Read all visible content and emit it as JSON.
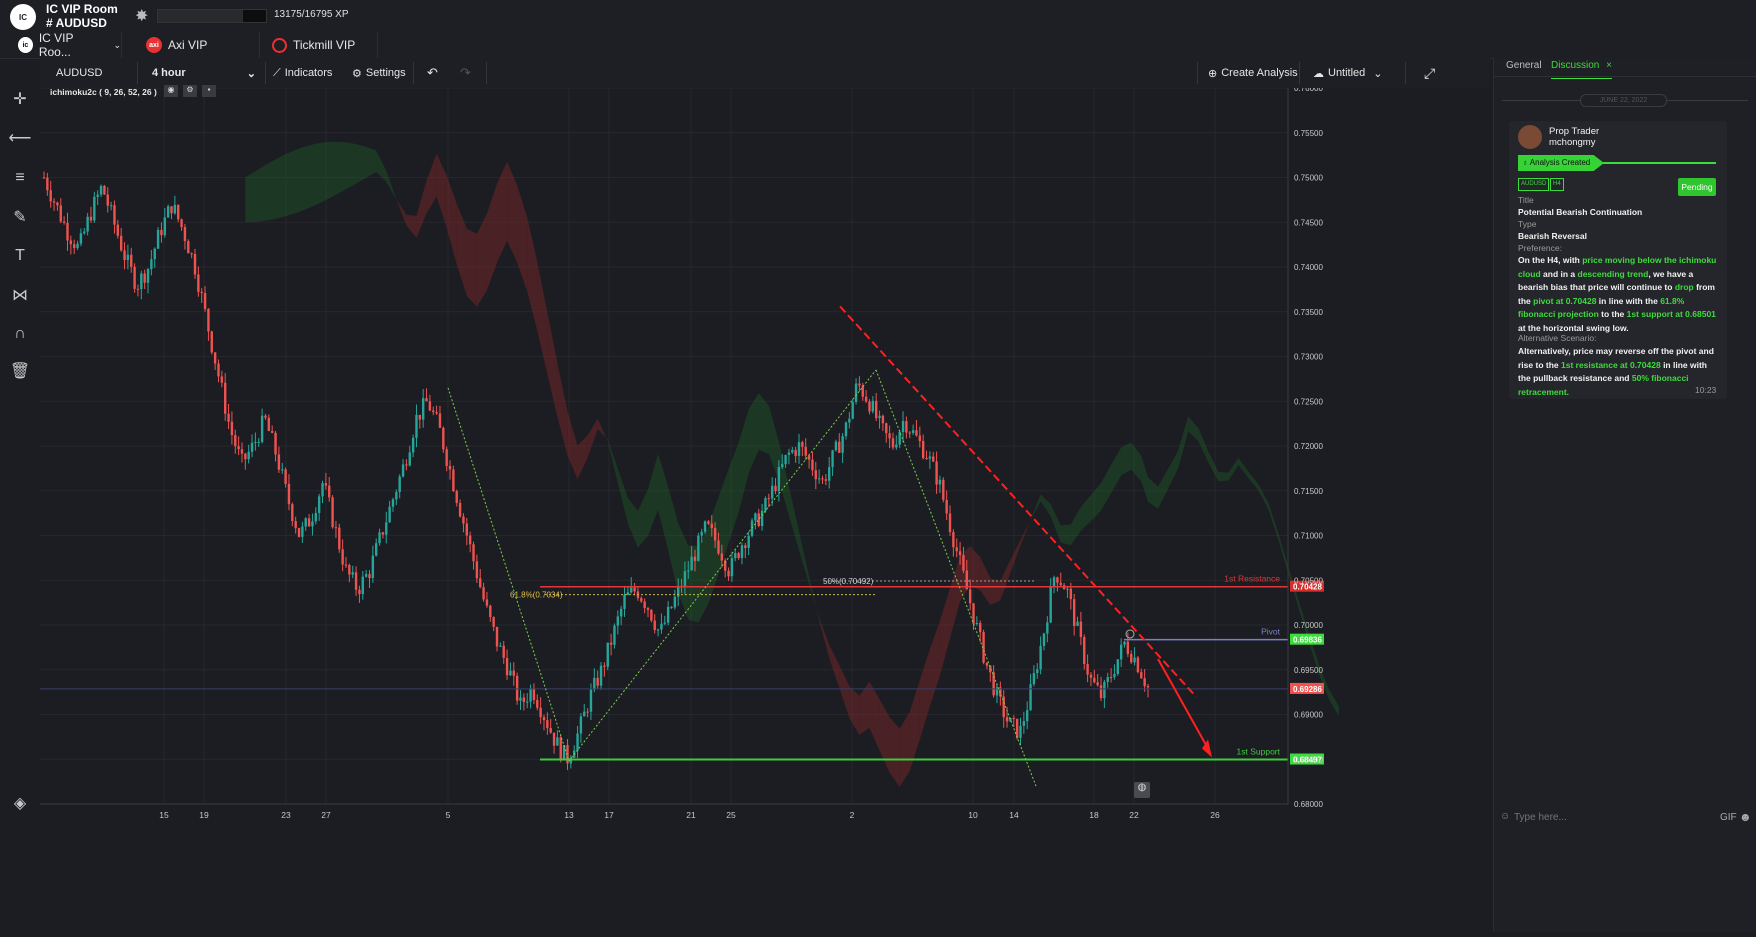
{
  "header": {
    "logo_text": "IC Markets",
    "room_title": "IC VIP Room",
    "room_channel": "# AUDUSD",
    "xp_text": "13175/16795 XP",
    "xp_progress": 0.785
  },
  "tabs": [
    {
      "label": "IC VIP Roo...",
      "icon": "ic-markets-icon",
      "color": "#ffffff"
    },
    {
      "label": "Axi VIP",
      "icon": "axi-icon",
      "color": "#e63232"
    },
    {
      "label": "Tickmill VIP",
      "icon": "tickmill-icon",
      "color": "#e63232"
    }
  ],
  "toolbar": {
    "symbol": "AUDUSD",
    "interval": "4 hour",
    "indicators_label": "Indicators",
    "settings_label": "Settings",
    "create_analysis_label": "Create Analysis",
    "layout_label": "Untitled"
  },
  "chart": {
    "indicator_label": "ichimoku2c ( 9, 26, 52, 26 )",
    "y_ticks": [
      "0.76000",
      "0.75500",
      "0.75000",
      "0.74500",
      "0.74000",
      "0.73500",
      "0.73000",
      "0.72500",
      "0.72000",
      "0.71500",
      "0.71000",
      "0.70500",
      "0.70000",
      "0.69500",
      "0.69000",
      "0.68500",
      "0.68000"
    ],
    "x_ticks": [
      "15",
      "19",
      "23",
      "27",
      "5",
      "13",
      "17",
      "21",
      "25",
      "2",
      "10",
      "14",
      "18",
      "22",
      "26"
    ],
    "resistance_label": "1st Resistance",
    "resistance_value": "0.70428",
    "pivot_label": "Pivot",
    "pivot_value": "0.69836",
    "current_value": "0.69286",
    "support_label": "1st Support",
    "support_value": "0.68497",
    "fib_618_label": "61.8%(0.7034)",
    "fib_50_label": "50%(0.70492)",
    "colors": {
      "up": "#26a69a",
      "down": "#ef5350",
      "resistance": "#e0373a",
      "support": "#3dcc3d",
      "pivot": "#7a80c8",
      "trend": "#ff2020"
    }
  },
  "chart_data": {
    "type": "candlestick",
    "symbol": "AUDUSD",
    "interval": "4 hour",
    "ylim": [
      0.68,
      0.76
    ],
    "x_tick_labels": [
      "15",
      "19",
      "23",
      "27",
      "5",
      "13",
      "17",
      "21",
      "25",
      "2",
      "10",
      "14",
      "18",
      "22",
      "26"
    ],
    "levels": [
      {
        "name": "1st Resistance",
        "value": 0.70428
      },
      {
        "name": "Pivot",
        "value": 0.69836
      },
      {
        "name": "1st Support",
        "value": 0.68497
      }
    ],
    "price_path": [
      0.75,
      0.747,
      0.744,
      0.742,
      0.746,
      0.749,
      0.745,
      0.741,
      0.738,
      0.74,
      0.744,
      0.747,
      0.744,
      0.74,
      0.734,
      0.728,
      0.722,
      0.718,
      0.72,
      0.723,
      0.719,
      0.714,
      0.71,
      0.712,
      0.716,
      0.711,
      0.706,
      0.704,
      0.706,
      0.71,
      0.714,
      0.718,
      0.723,
      0.725,
      0.722,
      0.717,
      0.712,
      0.707,
      0.702,
      0.698,
      0.695,
      0.691,
      0.693,
      0.69,
      0.687,
      0.685,
      0.688,
      0.692,
      0.695,
      0.699,
      0.703,
      0.704,
      0.702,
      0.699,
      0.702,
      0.705,
      0.708,
      0.711,
      0.709,
      0.706,
      0.709,
      0.711,
      0.713,
      0.716,
      0.719,
      0.72,
      0.718,
      0.716,
      0.719,
      0.722,
      0.727,
      0.725,
      0.722,
      0.72,
      0.723,
      0.721,
      0.719,
      0.716,
      0.711,
      0.706,
      0.701,
      0.696,
      0.692,
      0.689,
      0.688,
      0.693,
      0.699,
      0.706,
      0.704,
      0.699,
      0.694,
      0.692,
      0.695,
      0.698,
      0.696,
      0.693
    ]
  },
  "panel": {
    "tab_general": "General",
    "tab_discussion": "Discussion",
    "date_label": "JUNE 22, 2022",
    "author_role": "Prop Trader",
    "author_name": "mchongmy",
    "status_banner": "Analysis Created",
    "tag_symbol": "AUDUSD",
    "tag_tf": "H4",
    "pending_label": "Pending",
    "title_label": "Title",
    "title_value": "Potential Bearish Continuation",
    "type_label": "Type",
    "type_value": "Bearish Reversal",
    "pref_label": "Preference:",
    "pref_segments": [
      {
        "t": "On the H4, with ",
        "hl": false
      },
      {
        "t": "price moving below the ichimoku cloud",
        "hl": true
      },
      {
        "t": " and in a ",
        "hl": false
      },
      {
        "t": "descending trend",
        "hl": true
      },
      {
        "t": ", we have a bearish bias that price will continue to ",
        "hl": false
      },
      {
        "t": "drop",
        "hl": true
      },
      {
        "t": " from the ",
        "hl": false
      },
      {
        "t": "pivot at 0.70428",
        "hl": true
      },
      {
        "t": " in line with the ",
        "hl": false
      },
      {
        "t": "61.8% fibonacci projection",
        "hl": true
      },
      {
        "t": " to the ",
        "hl": false
      },
      {
        "t": "1st support at 0.68501",
        "hl": true
      },
      {
        "t": " at the horizontal swing low.",
        "hl": false
      }
    ],
    "alt_label": "Alternative Scenario:",
    "alt_segments": [
      {
        "t": "Alternatively, price may reverse off the pivot and rise to the ",
        "hl": false
      },
      {
        "t": "1st resistance at 0.70428",
        "hl": true
      },
      {
        "t": " in line with the pullback resistance and ",
        "hl": false
      },
      {
        "t": "50% fibonacci retracement.",
        "hl": true
      }
    ],
    "time": "10:23",
    "input_placeholder": "Type here...",
    "gif_label": "GIF"
  }
}
